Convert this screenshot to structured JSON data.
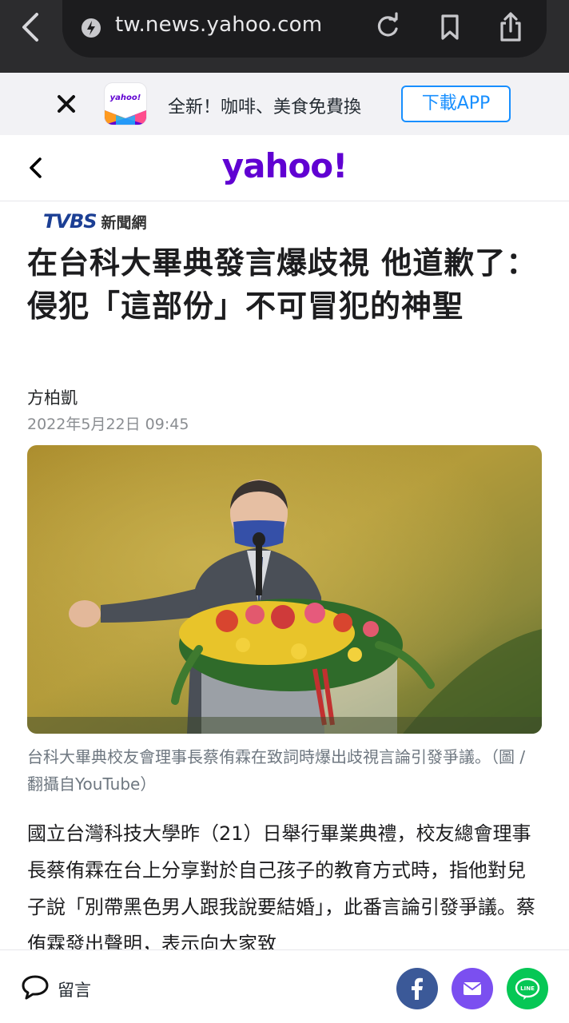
{
  "browser": {
    "url": "tw.news.yahoo.com"
  },
  "promo": {
    "text": "全新！咖啡、美食免費換",
    "button": "下載APP",
    "logo_text": "yahoo!"
  },
  "header": {
    "logo": "yahoo!"
  },
  "article": {
    "source_brand": "TVBS",
    "source_label": "新聞網",
    "headline": "在台科大畢典發言爆歧視 他道歉了：侵犯「這部份」不可冒犯的神聖",
    "author": "方柏凱",
    "date": "2022年5月22日 09:45",
    "caption": "台科大畢典校友會理事長蔡侑霖在致詞時爆出歧視言論引發爭議。（圖 / 翻攝自YouTube）",
    "body": "國立台灣科技大學昨（21）日舉行畢業典禮，校友總會理事長蔡侑霖在台上分享對於自己孩子的教育方式時，指他對兒子說「別帶黑色男人跟我說要結婚」，此番言論引發爭議。蔡侑霖發出聲明，表示向大家致"
  },
  "bottom": {
    "comment_label": "留言"
  },
  "colors": {
    "yahoo_purple": "#6001d2",
    "facebook": "#3b5998",
    "mail": "#7b4ff0",
    "line": "#06c755",
    "app_button": "#188fff"
  }
}
